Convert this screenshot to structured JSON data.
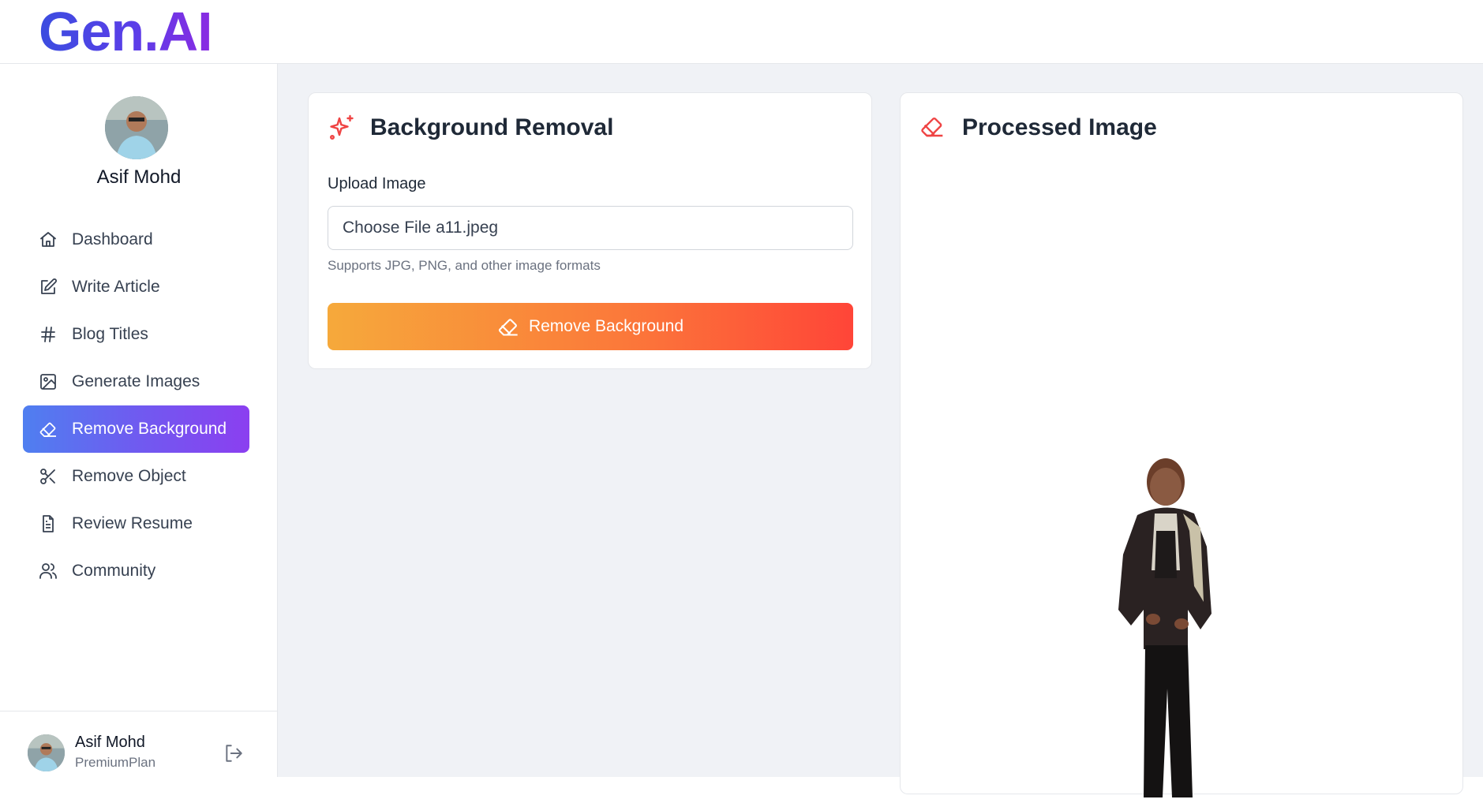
{
  "app": {
    "logo_text": "Gen.AI"
  },
  "sidebar": {
    "profile_name": "Asif Mohd",
    "items": [
      {
        "label": "Dashboard",
        "icon": "home-icon",
        "active": false
      },
      {
        "label": "Write Article",
        "icon": "edit-icon",
        "active": false
      },
      {
        "label": "Blog Titles",
        "icon": "hash-icon",
        "active": false
      },
      {
        "label": "Generate Images",
        "icon": "image-icon",
        "active": false
      },
      {
        "label": "Remove Background",
        "icon": "eraser-icon",
        "active": true
      },
      {
        "label": "Remove Object",
        "icon": "scissors-icon",
        "active": false
      },
      {
        "label": "Review Resume",
        "icon": "file-text-icon",
        "active": false
      },
      {
        "label": "Community",
        "icon": "users-icon",
        "active": false
      }
    ],
    "footer": {
      "name": "Asif Mohd",
      "plan": "PremiumPlan",
      "logout_icon": "logout-icon"
    }
  },
  "left_card": {
    "title": "Background Removal",
    "icon": "sparkles-icon",
    "upload_label": "Upload Image",
    "file_button": "Choose File",
    "file_name": "a11.jpeg",
    "hint": "Supports JPG, PNG, and other image formats",
    "button_label": "Remove Background",
    "button_icon": "eraser-icon"
  },
  "right_card": {
    "title": "Processed Image",
    "icon": "eraser-icon"
  },
  "colors": {
    "brand_gradient_start": "#3b4de0",
    "brand_gradient_end": "#8a2be2",
    "active_nav_start": "#4f7ff0",
    "active_nav_end": "#8b3ff0",
    "action_start": "#f6a93b",
    "action_end": "#ff4538",
    "accent_icon": "#ef4444"
  }
}
